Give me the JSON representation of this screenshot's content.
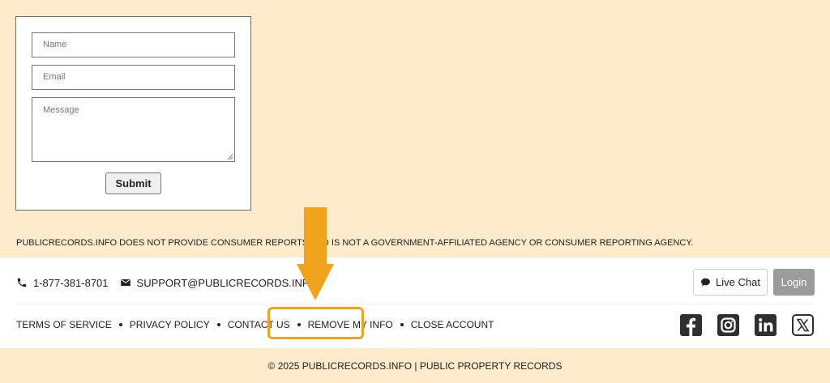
{
  "form": {
    "name_placeholder": "Name",
    "email_placeholder": "Email",
    "message_placeholder": "Message",
    "submit_label": "Submit"
  },
  "disclaimer": "PUBLICRECORDS.INFO DOES NOT PROVIDE CONSUMER REPORTS AND IS NOT A GOVERNMENT-AFFILIATED AGENCY OR CONSUMER REPORTING AGENCY.",
  "contact": {
    "phone": "1-877-381-8701",
    "email": "SUPPORT@PUBLICRECORDS.INFO",
    "phone_icon": "phone-icon",
    "email_icon": "envelope-icon"
  },
  "buttons": {
    "live_chat": "Live Chat",
    "login": "Login",
    "chat_icon": "chat-bubble-icon"
  },
  "footer_links": [
    {
      "label": "TERMS OF SERVICE"
    },
    {
      "label": "PRIVACY POLICY"
    },
    {
      "label": "CONTACT US"
    },
    {
      "label": "REMOVE MY INFO"
    },
    {
      "label": "CLOSE ACCOUNT"
    }
  ],
  "socials": [
    "facebook-icon",
    "instagram-icon",
    "linkedin-icon",
    "x-icon"
  ],
  "copyright": "© 2025 PUBLICRECORDS.INFO | PUBLIC PROPERTY RECORDS",
  "colors": {
    "background": "#fdebcb",
    "highlight": "#f0a31a",
    "login_bg": "#9b9b9b"
  }
}
